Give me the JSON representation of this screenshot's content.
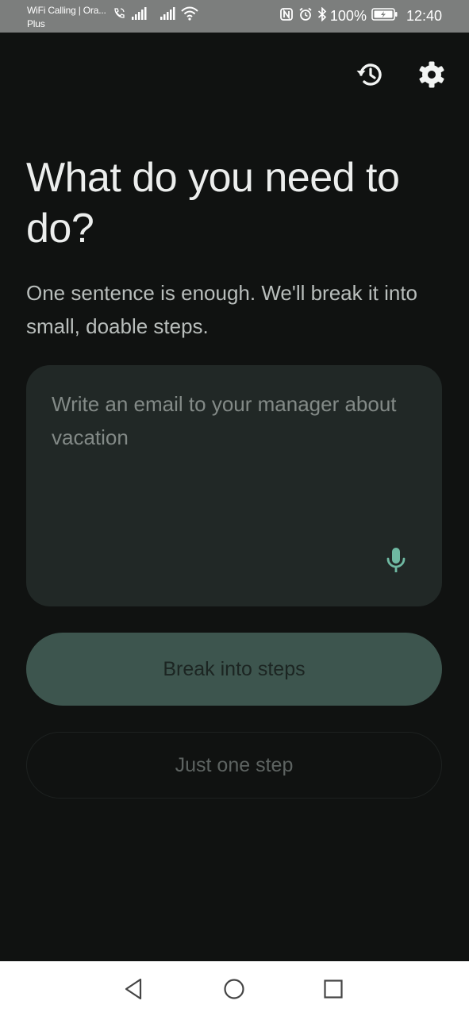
{
  "status_bar": {
    "carrier_line1": "WiFi Calling | Ora...",
    "carrier_line2": "Plus",
    "battery_percent": "100%",
    "time": "12:40",
    "icons": [
      "wifi-call-icon",
      "signal-icon",
      "signal-icon",
      "wifi-icon",
      "nfc-icon",
      "alarm-icon",
      "bluetooth-icon",
      "battery-icon"
    ]
  },
  "header": {
    "icons": [
      "history-icon",
      "gear-icon"
    ]
  },
  "main": {
    "title": "What do you need to do?",
    "subtitle": "One sentence is enough. We'll break it into small, doable steps."
  },
  "task_input": {
    "value": "",
    "placeholder": "Write an email to your manager about vacation",
    "mic_icon": "microphone-icon"
  },
  "actions": {
    "primary_label": "Break into steps",
    "secondary_label": "Just one step"
  },
  "nav_bar": {
    "icons": [
      "back-icon",
      "home-icon",
      "recents-icon"
    ]
  },
  "colors": {
    "background": "#101211",
    "card": "#212826",
    "accent": "#6fb9a2",
    "primary_button": "#3d554e",
    "status_bar": "#7c7e7d"
  }
}
